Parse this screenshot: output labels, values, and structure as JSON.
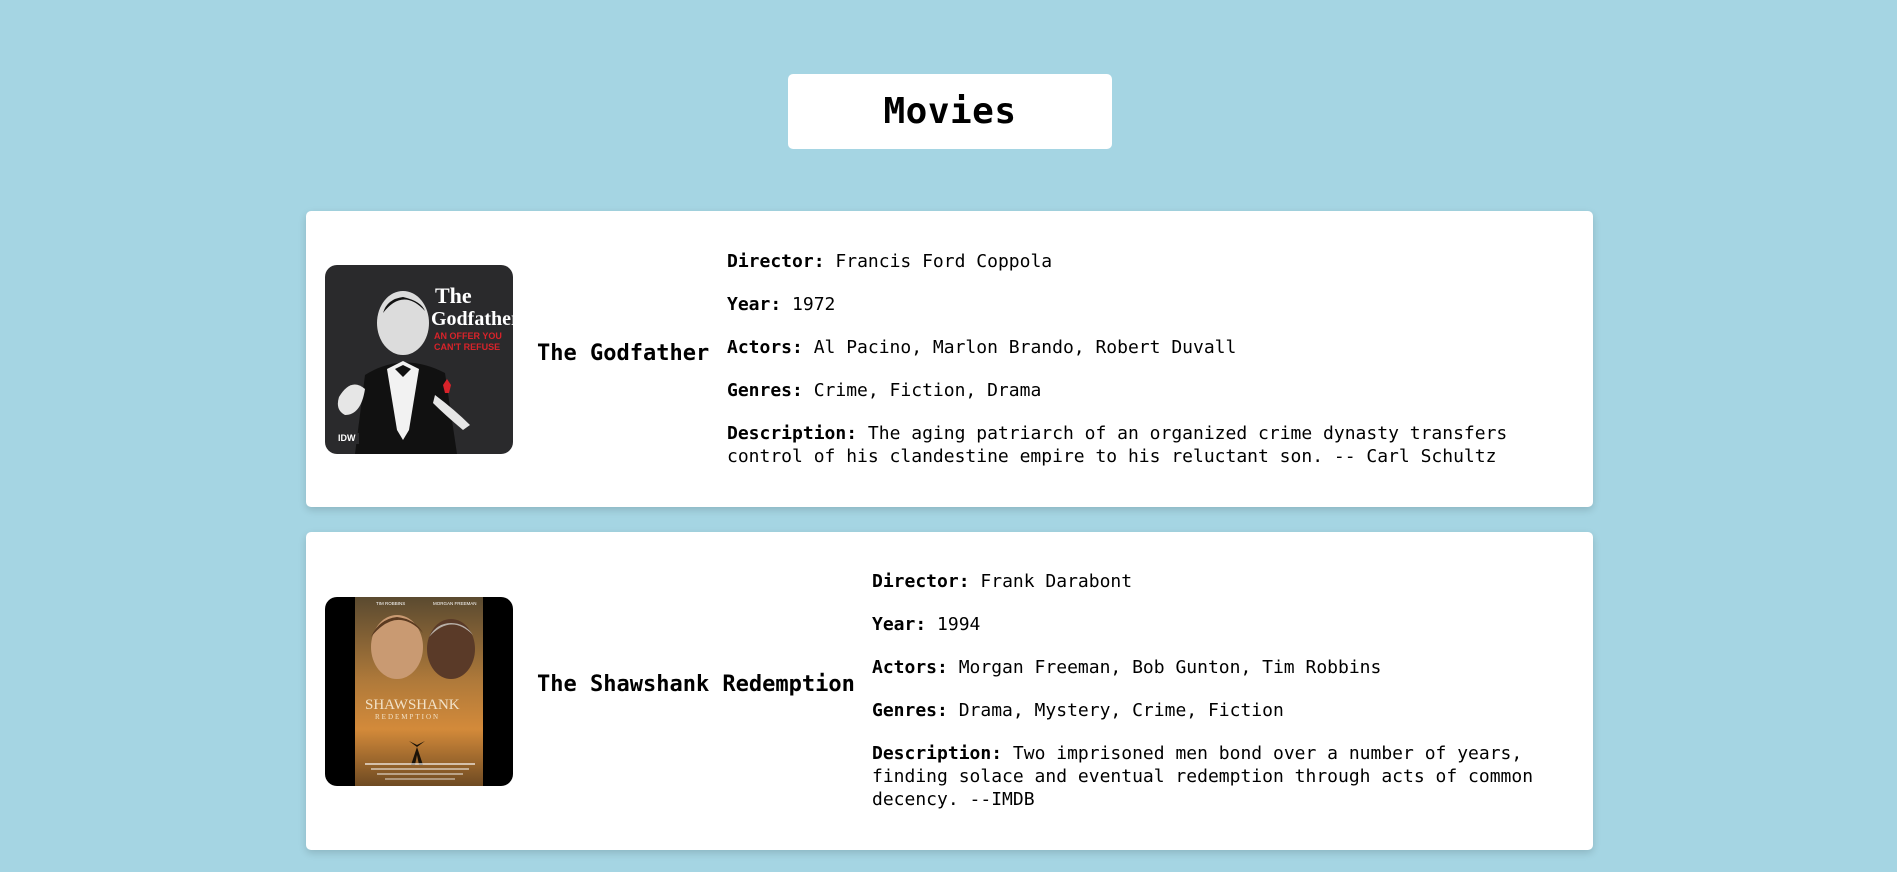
{
  "page": {
    "title": "Movies"
  },
  "labels": {
    "director": "Director:",
    "year": "Year:",
    "actors": "Actors:",
    "genres": "Genres:",
    "description": "Description:"
  },
  "movies": [
    {
      "title": "The Godfather",
      "director": "Francis Ford Coppola",
      "year": "1972",
      "actors": "Al Pacino, Marlon Brando, Robert Duvall",
      "genres": "Crime, Fiction, Drama",
      "description": "The aging patriarch of an organized crime dynasty transfers control of his clandestine empire to his reluctant son. -- Carl Schultz",
      "poster": {
        "headline_line1": "The",
        "headline_line2": "Godfather",
        "tagline_line1": "AN OFFER YOU",
        "tagline_line2": "CAN'T REFUSE",
        "publisher": "IDW",
        "background": "#2a2a2c",
        "accent": "#d8232a"
      }
    },
    {
      "title": "The Shawshank Redemption",
      "director": "Frank Darabont",
      "year": "1994",
      "actors": "Morgan Freeman, Bob Gunton, Tim Robbins",
      "genres": "Drama, Mystery, Crime, Fiction",
      "description": "Two imprisoned men bond over a number of years, finding solace and eventual redemption through acts of common decency. --IMDB",
      "poster": {
        "top_left_name": "TIM ROBBINS",
        "top_right_name": "MORGAN FREEMAN",
        "headline_line1": "SHAWSHANK",
        "headline_line2": "REDEMPTION",
        "background": "#000000",
        "accent": "#d38a3a"
      }
    }
  ]
}
